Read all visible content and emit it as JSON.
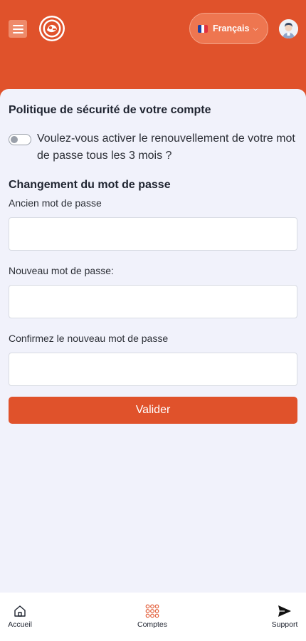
{
  "header": {
    "language": {
      "label": "Français",
      "flag_colors": [
        "#1e3fa0",
        "#ffffff",
        "#e03040"
      ]
    },
    "brand_color": "#e0522b",
    "icons": {
      "menu": "hamburger-menu-icon",
      "logo": "brand-logo-icon",
      "language_chevron": "chevron-down-icon",
      "profile": "user-avatar-icon"
    }
  },
  "security_policy": {
    "title": "Politique de sécurité de votre compte",
    "toggle_label": "Voulez-vous activer le renouvellement de votre mot de passe tous les 3 mois ?",
    "toggle_on": false
  },
  "password_change": {
    "title": "Changement du mot de passe",
    "old_password": {
      "label": "Ancien mot de passe",
      "value": ""
    },
    "new_password": {
      "label": "Nouveau mot de passe:",
      "value": ""
    },
    "confirm_password": {
      "label": "Confirmez le nouveau mot de passe",
      "value": ""
    },
    "submit_label": "Valider"
  },
  "bottom_nav": {
    "items": [
      {
        "label": "Accueil",
        "icon": "home-icon"
      },
      {
        "label": "Comptes",
        "icon": "grid-icon"
      },
      {
        "label": "Support",
        "icon": "send-icon"
      }
    ]
  }
}
